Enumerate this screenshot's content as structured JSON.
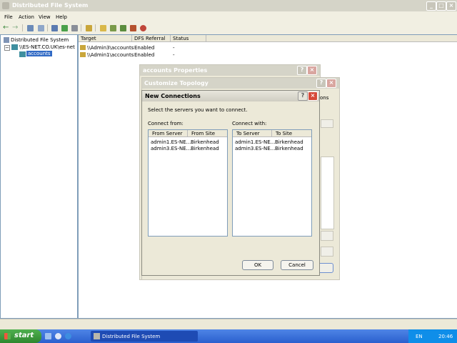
{
  "main_window": {
    "title": "Distributed File System",
    "menu": [
      "File",
      "Action",
      "View",
      "Help"
    ]
  },
  "tree": {
    "root": "Distributed File System",
    "child": "\\\\ES-NET.CO.UK\\es-net",
    "grandchild": "accounts"
  },
  "list": {
    "columns": [
      "Target",
      "DFS Referral",
      "Status"
    ],
    "rows": [
      {
        "target": "\\\\Admin3\\accounts",
        "referral": "Enabled",
        "status": "-"
      },
      {
        "target": "\\\\Admin1\\accounts",
        "referral": "Enabled",
        "status": "-"
      }
    ]
  },
  "accounts_properties": {
    "title": "accounts Properties"
  },
  "customize_topology": {
    "title": "Customize Topology",
    "peek_text": "ons"
  },
  "dialog": {
    "title": "New Connections",
    "instruction": "Select the servers you want to connect.",
    "from_label": "Connect from:",
    "with_label": "Connect with:",
    "from_columns": [
      "From Server",
      "From Site"
    ],
    "with_columns": [
      "To Server",
      "To Site"
    ],
    "from_rows": [
      {
        "server": "admin1.ES-NE...",
        "site": "Birkenhead"
      },
      {
        "server": "admin3.ES-NE...",
        "site": "Birkenhead"
      }
    ],
    "with_rows": [
      {
        "server": "admin1.ES-NE...",
        "site": "Birkenhead"
      },
      {
        "server": "admin3.ES-NE...",
        "site": "Birkenhead"
      }
    ],
    "ok_label": "OK",
    "cancel_label": "Cancel"
  },
  "taskbar": {
    "start_label": "start",
    "task_label": "Distributed File System",
    "lang": "EN",
    "clock": "20:46"
  },
  "colors": {
    "taskbar": "#3a6fd8",
    "start": "#3c9a3c",
    "window_bg": "#f1efe2"
  }
}
